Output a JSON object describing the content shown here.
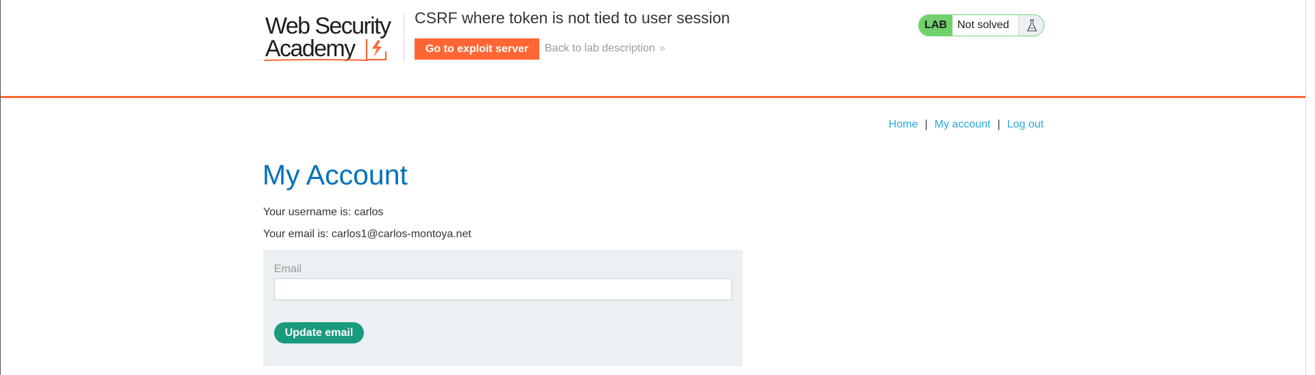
{
  "header": {
    "logo": {
      "line1": "Web Security",
      "line2": "Academy",
      "accent_color": "#ff6633"
    },
    "lab_title": "CSRF where token is not tied to user session",
    "exploit_button": "Go to exploit server",
    "back_link": "Back to lab description",
    "back_link_chevron": "»",
    "status": {
      "lab_label": "LAB",
      "state": "Not solved",
      "icon": "flask-icon",
      "color": "#70d16d"
    }
  },
  "nav": {
    "home": "Home",
    "separator": "|",
    "my_account": "My account",
    "log_out": "Log out"
  },
  "main": {
    "title": "My Account",
    "username_line": "Your username is: carlos",
    "email_line": "Your email is: carlos1@carlos-montoya.net",
    "form": {
      "email_label": "Email",
      "email_value": "",
      "submit_label": "Update email"
    }
  },
  "colors": {
    "title": "#0071bc",
    "link": "#29a8e0",
    "button": "#1a9b7e",
    "form_bg": "#ebf0f2"
  }
}
